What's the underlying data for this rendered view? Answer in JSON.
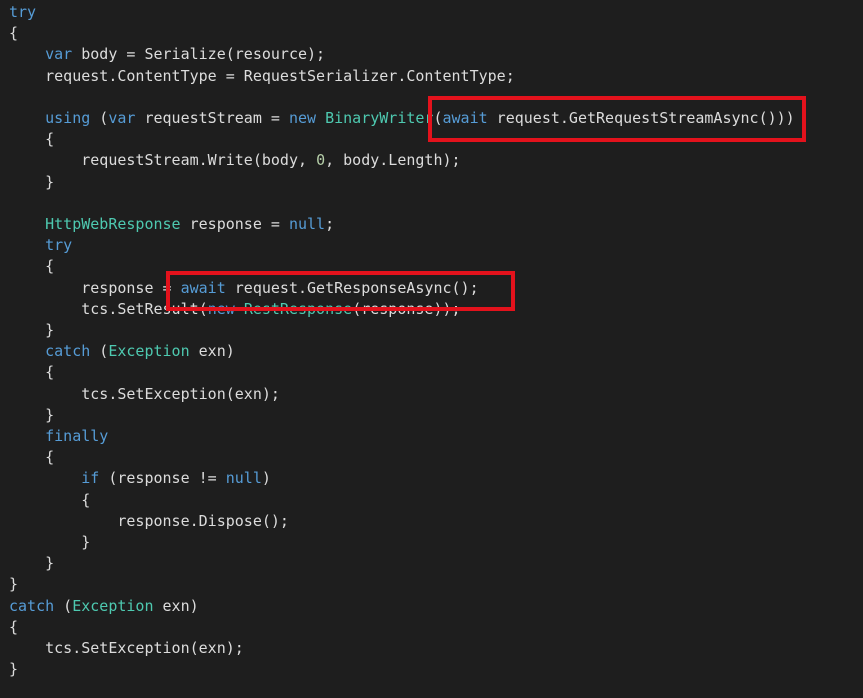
{
  "editor": {
    "theme_colors": {
      "background": "#1e1e1e",
      "keyword": "#569cd6",
      "type": "#4ec9b0",
      "number": "#b5cea8",
      "plain": "#dcdcdc",
      "highlight_border": "#e3121c"
    },
    "lines": [
      {
        "indent": "",
        "tokens": [
          {
            "t": "try",
            "k": "keyword"
          }
        ]
      },
      {
        "indent": "",
        "tokens": [
          {
            "t": "{",
            "k": "plain"
          }
        ]
      },
      {
        "indent": "    ",
        "tokens": [
          {
            "t": "var",
            "k": "keyword"
          },
          {
            "t": " body = Serialize(resource);",
            "k": "plain"
          }
        ]
      },
      {
        "indent": "    ",
        "tokens": [
          {
            "t": "request.ContentType = RequestSerializer.ContentType;",
            "k": "plain"
          }
        ]
      },
      {
        "indent": "",
        "tokens": []
      },
      {
        "indent": "    ",
        "tokens": [
          {
            "t": "using",
            "k": "keyword"
          },
          {
            "t": " (",
            "k": "plain"
          },
          {
            "t": "var",
            "k": "keyword"
          },
          {
            "t": " requestStream = ",
            "k": "plain"
          },
          {
            "t": "new",
            "k": "keyword"
          },
          {
            "t": " ",
            "k": "plain"
          },
          {
            "t": "BinaryWriter",
            "k": "type"
          },
          {
            "t": "(",
            "k": "plain"
          },
          {
            "t": "await",
            "k": "keyword"
          },
          {
            "t": " request.GetRequestStreamAsync()))",
            "k": "plain"
          }
        ]
      },
      {
        "indent": "    ",
        "tokens": [
          {
            "t": "{",
            "k": "plain"
          }
        ]
      },
      {
        "indent": "        ",
        "tokens": [
          {
            "t": "requestStream.Write(body, ",
            "k": "plain"
          },
          {
            "t": "0",
            "k": "number"
          },
          {
            "t": ", body.Length);",
            "k": "plain"
          }
        ]
      },
      {
        "indent": "    ",
        "tokens": [
          {
            "t": "}",
            "k": "plain"
          }
        ]
      },
      {
        "indent": "",
        "tokens": []
      },
      {
        "indent": "    ",
        "tokens": [
          {
            "t": "HttpWebResponse",
            "k": "type"
          },
          {
            "t": " response = ",
            "k": "plain"
          },
          {
            "t": "null",
            "k": "keyword"
          },
          {
            "t": ";",
            "k": "plain"
          }
        ]
      },
      {
        "indent": "    ",
        "tokens": [
          {
            "t": "try",
            "k": "keyword"
          }
        ]
      },
      {
        "indent": "    ",
        "tokens": [
          {
            "t": "{",
            "k": "plain"
          }
        ]
      },
      {
        "indent": "        ",
        "tokens": [
          {
            "t": "response = ",
            "k": "plain"
          },
          {
            "t": "await",
            "k": "keyword"
          },
          {
            "t": " request.GetResponseAsync();",
            "k": "plain"
          }
        ]
      },
      {
        "indent": "        ",
        "tokens": [
          {
            "t": "tcs.SetResult(",
            "k": "plain"
          },
          {
            "t": "new",
            "k": "keyword"
          },
          {
            "t": " ",
            "k": "plain"
          },
          {
            "t": "RestResponse",
            "k": "type"
          },
          {
            "t": "(response));",
            "k": "plain"
          }
        ]
      },
      {
        "indent": "    ",
        "tokens": [
          {
            "t": "}",
            "k": "plain"
          }
        ]
      },
      {
        "indent": "    ",
        "tokens": [
          {
            "t": "catch",
            "k": "keyword"
          },
          {
            "t": " (",
            "k": "plain"
          },
          {
            "t": "Exception",
            "k": "type"
          },
          {
            "t": " exn)",
            "k": "plain"
          }
        ]
      },
      {
        "indent": "    ",
        "tokens": [
          {
            "t": "{",
            "k": "plain"
          }
        ]
      },
      {
        "indent": "        ",
        "tokens": [
          {
            "t": "tcs.SetException(exn);",
            "k": "plain"
          }
        ]
      },
      {
        "indent": "    ",
        "tokens": [
          {
            "t": "}",
            "k": "plain"
          }
        ]
      },
      {
        "indent": "    ",
        "tokens": [
          {
            "t": "finally",
            "k": "keyword"
          }
        ]
      },
      {
        "indent": "    ",
        "tokens": [
          {
            "t": "{",
            "k": "plain"
          }
        ]
      },
      {
        "indent": "        ",
        "tokens": [
          {
            "t": "if",
            "k": "keyword"
          },
          {
            "t": " (response != ",
            "k": "plain"
          },
          {
            "t": "null",
            "k": "keyword"
          },
          {
            "t": ")",
            "k": "plain"
          }
        ]
      },
      {
        "indent": "        ",
        "tokens": [
          {
            "t": "{",
            "k": "plain"
          }
        ]
      },
      {
        "indent": "            ",
        "tokens": [
          {
            "t": "response.Dispose();",
            "k": "plain"
          }
        ]
      },
      {
        "indent": "        ",
        "tokens": [
          {
            "t": "}",
            "k": "plain"
          }
        ]
      },
      {
        "indent": "    ",
        "tokens": [
          {
            "t": "}",
            "k": "plain"
          }
        ]
      },
      {
        "indent": "",
        "tokens": [
          {
            "t": "}",
            "k": "plain"
          }
        ]
      },
      {
        "indent": "",
        "tokens": [
          {
            "t": "catch",
            "k": "keyword"
          },
          {
            "t": " (",
            "k": "plain"
          },
          {
            "t": "Exception",
            "k": "type"
          },
          {
            "t": " exn)",
            "k": "plain"
          }
        ]
      },
      {
        "indent": "",
        "tokens": [
          {
            "t": "{",
            "k": "plain"
          }
        ]
      },
      {
        "indent": "    ",
        "tokens": [
          {
            "t": "tcs.SetException(exn);",
            "k": "plain"
          }
        ]
      },
      {
        "indent": "",
        "tokens": [
          {
            "t": "}",
            "k": "plain"
          }
        ]
      }
    ]
  }
}
